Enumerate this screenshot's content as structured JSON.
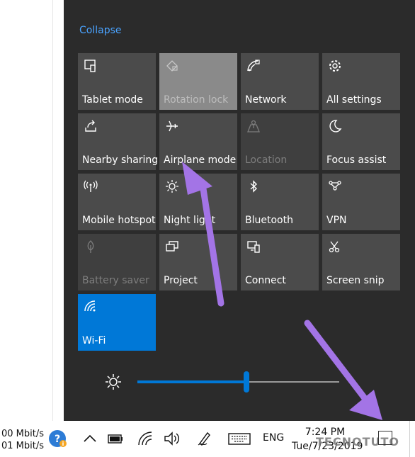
{
  "action_center": {
    "collapse_label": "Collapse",
    "tiles": [
      {
        "label": "Tablet mode",
        "icon": "tablet-mode-icon"
      },
      {
        "label": "Rotation lock",
        "icon": "rotation-lock-icon"
      },
      {
        "label": "Network",
        "icon": "network-icon"
      },
      {
        "label": "All settings",
        "icon": "gear-icon"
      },
      {
        "label": "Nearby sharing",
        "icon": "nearby-sharing-icon"
      },
      {
        "label": "Airplane mode",
        "icon": "airplane-icon"
      },
      {
        "label": "Location",
        "icon": "location-icon"
      },
      {
        "label": "Focus assist",
        "icon": "moon-icon"
      },
      {
        "label": "Mobile hotspot",
        "icon": "hotspot-icon"
      },
      {
        "label": "Night light",
        "icon": "sun-icon"
      },
      {
        "label": "Bluetooth",
        "icon": "bluetooth-icon"
      },
      {
        "label": "VPN",
        "icon": "vpn-icon"
      },
      {
        "label": "Battery saver",
        "icon": "battery-saver-icon"
      },
      {
        "label": "Project",
        "icon": "project-icon"
      },
      {
        "label": "Connect",
        "icon": "connect-icon"
      },
      {
        "label": "Screen snip",
        "icon": "scissors-icon"
      },
      {
        "label": "Wi-Fi",
        "icon": "wifi-icon"
      }
    ],
    "brightness": {
      "value_percent": 54,
      "icon": "brightness-icon"
    }
  },
  "taskbar": {
    "net_speed_up": "00 Mbit/s",
    "net_speed_down": "01 Mbit/s",
    "language": "ENG",
    "time": "7:24 PM",
    "date": "Tue/7/23/2019",
    "watermark": "TECNOTUTO"
  },
  "colors": {
    "accent": "#0078d7",
    "tile": "#4b4b4b",
    "panel": "#2b2b2b",
    "arrow": "#a374e6"
  }
}
